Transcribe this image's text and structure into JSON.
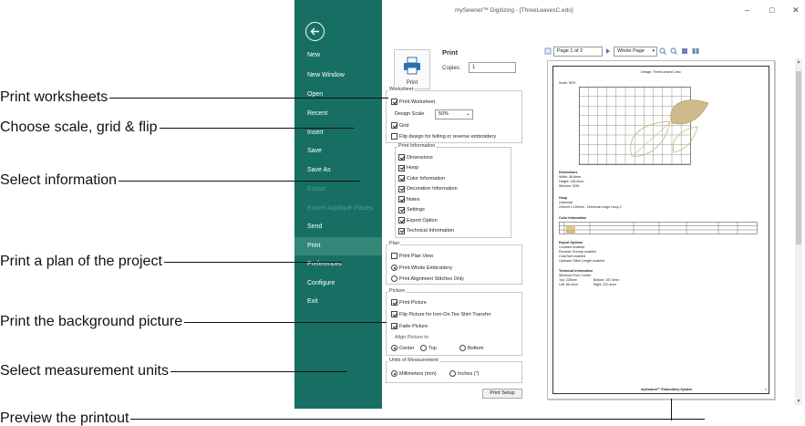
{
  "callouts": {
    "print_worksheets": "Print worksheets",
    "choose_scale": "Choose scale, grid & flip",
    "select_information": "Select information",
    "print_plan": "Print a plan of the project",
    "print_background": "Print the background picture",
    "select_units": "Select measurement units",
    "preview_printout": "Preview the printout"
  },
  "window": {
    "title": "mySewnet™ Digitizing - [ThreeLeavesC.edo]",
    "minimize": "–",
    "maximize": "□",
    "close": "✕"
  },
  "sidebar": {
    "items": [
      {
        "label": "New",
        "state": "normal"
      },
      {
        "label": "New Window",
        "state": "normal"
      },
      {
        "label": "Open",
        "state": "normal"
      },
      {
        "label": "Recent",
        "state": "normal"
      },
      {
        "label": "Insert",
        "state": "normal"
      },
      {
        "label": "Save",
        "state": "normal"
      },
      {
        "label": "Save As",
        "state": "normal"
      },
      {
        "label": "Export",
        "state": "disabled"
      },
      {
        "label": "Export Appliqué Pieces",
        "state": "disabled"
      },
      {
        "label": "Send",
        "state": "normal"
      },
      {
        "label": "Print",
        "state": "active"
      },
      {
        "label": "Preferences",
        "state": "normal"
      },
      {
        "label": "Configure",
        "state": "normal"
      },
      {
        "label": "Exit",
        "state": "normal"
      }
    ]
  },
  "print_panel": {
    "heading": "Print",
    "print_button_label": "Print",
    "copies_label": "Copies:",
    "copies_value": "1",
    "worksheet": {
      "title": "Worksheet",
      "print_worksheet": "Print Worksheet",
      "design_scale_label": "Design Scale",
      "design_scale_value": "50%",
      "grid": "Grid",
      "flip": "Flip design for felting or reverse embroidery"
    },
    "print_information": {
      "title": "Print Information",
      "items": [
        "Dimensions",
        "Hoop",
        "Color Information",
        "Decoration Information",
        "Notes",
        "Settings",
        "Export Option",
        "Technical Information"
      ]
    },
    "plan": {
      "title": "Plan",
      "print_plan_view": "Print Plan View",
      "whole": "Print Whole Embroidery",
      "alignment": "Print Alignment Stitches Only"
    },
    "picture": {
      "title": "Picture",
      "print_picture": "Print Picture",
      "flip_iron_on": "Flip Picture for Iron-On Tee Shirt Transfer",
      "fade": "Fade Picture",
      "align_label": "Align Picture to",
      "center": "Center",
      "top": "Top",
      "bottom": "Bottom"
    },
    "units": {
      "title": "Units of Measurement",
      "mm": "Millimeters (mm)",
      "inches": "Inches (\")"
    },
    "print_setup": "Print Setup"
  },
  "preview": {
    "page_label": "Page 1 of 2",
    "zoom_label": "Whole Page",
    "page": {
      "design_title": "Design: ThreeLeavesC.edo",
      "scale": "Scale: 50%",
      "dimensions_title": "Dimensions",
      "dimensions_lines": [
        "Width:  56.8mm",
        "Height:  145.0mm",
        "Stitches: 5261"
      ],
      "hoop_title": "Hoop",
      "hoop_lines": [
        "Universal",
        "240mm x 150mm - Universal Large Hoop 2"
      ],
      "color_title": "Color Information",
      "export_title": "Export Options",
      "export_lines": [
        "Combine enabled",
        "Remove Overlap enabled",
        "ColorSort enabled",
        "Optimize Stitch Length enabled"
      ],
      "tech_title": "Technical Information",
      "tech_lines": [
        "Stitchout From Center",
        "Top:  225mm",
        "Left:  86.4mm"
      ],
      "tech_right": [
        "Bottom:  167.5mm",
        "Right:  220.4mm"
      ],
      "footer": "mySewnet™ Embroidery System",
      "page_number": "1"
    }
  }
}
